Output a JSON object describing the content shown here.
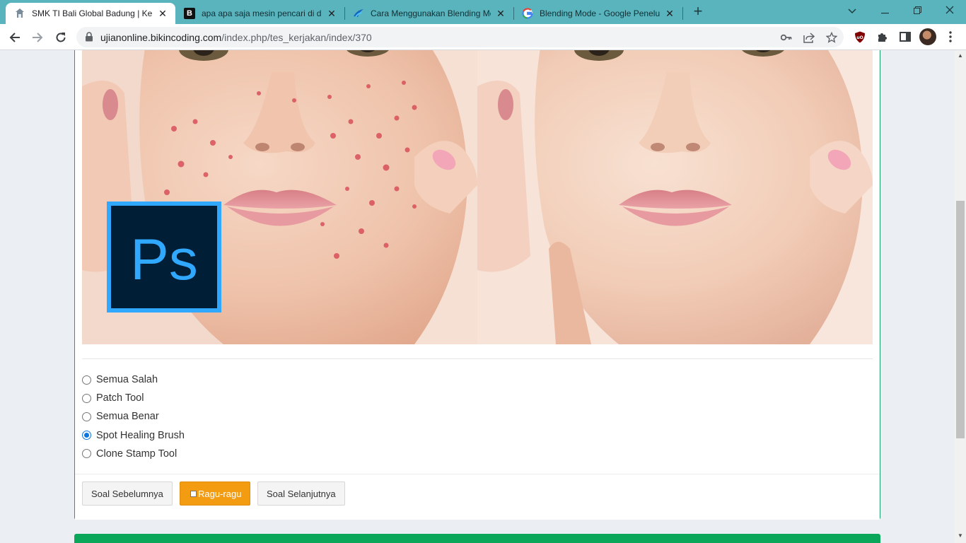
{
  "browser": {
    "tabs": [
      {
        "title": "SMK TI Bali Global Badung | Kerjakan",
        "active": true,
        "icon": "school-logo-icon"
      },
      {
        "title": "apa apa saja mesin pencari di dalam",
        "active": false,
        "icon": "b-logo-icon"
      },
      {
        "title": "Cara Menggunakan Blending Mode",
        "active": false,
        "icon": "wing-logo-icon"
      },
      {
        "title": "Blending Mode - Google Penelusuran",
        "active": false,
        "icon": "google-icon"
      }
    ],
    "url_host": "ujianonline.bikincoding.com",
    "url_path": "/index.php/tes_kerjakan/index/370"
  },
  "question": {
    "image_logo_text": "Ps",
    "options": [
      {
        "label": "Semua Salah",
        "checked": false
      },
      {
        "label": "Patch Tool",
        "checked": false
      },
      {
        "label": "Semua Benar",
        "checked": false
      },
      {
        "label": "Spot Healing Brush",
        "checked": true
      },
      {
        "label": "Clone Stamp Tool",
        "checked": false
      }
    ]
  },
  "footer": {
    "prev_label": "Soal Sebelumnya",
    "doubt_label": "Ragu-ragu",
    "next_label": "Soal Selanjutnya"
  },
  "colors": {
    "tabbar": "#5ab4bd",
    "card_border": "#1e9e6a",
    "doubt_button": "#f39c12",
    "radio_checked": "#0b76e0",
    "bottom_bar": "#0aa65a"
  }
}
